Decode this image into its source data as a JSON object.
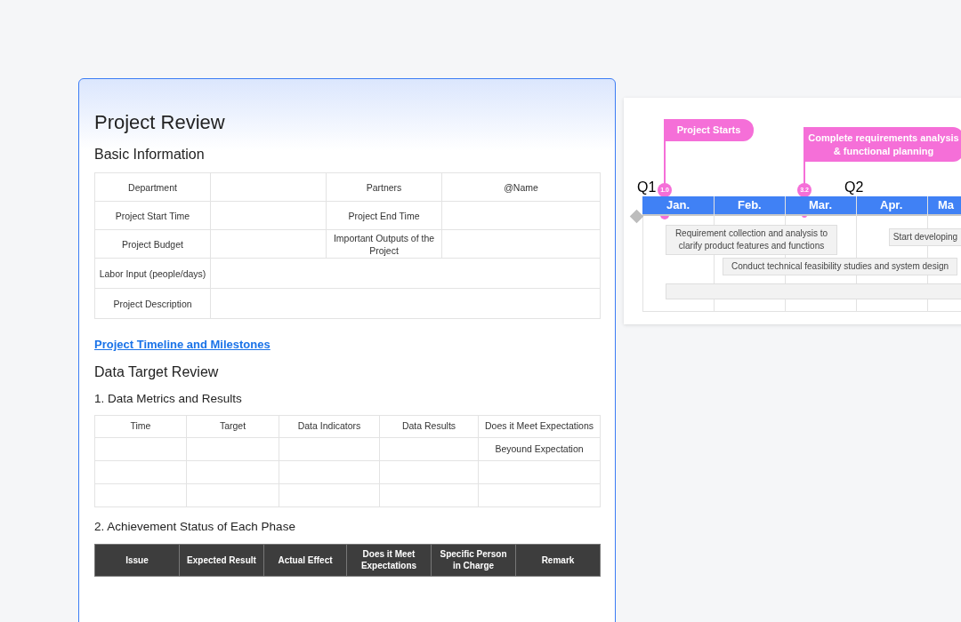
{
  "document": {
    "title": "Project Review",
    "sections": [
      {
        "kind": "heading",
        "text": "Basic Information"
      },
      {
        "kind": "info_table",
        "rows": [
          {
            "cells": [
              "Department",
              "",
              "Partners",
              "@Name"
            ]
          },
          {
            "cells": [
              "Project Start Time",
              "",
              "Project End Time",
              ""
            ]
          },
          {
            "cells": [
              "Project Budget",
              "",
              "Important Outputs of the Project",
              ""
            ]
          },
          {
            "cells": [
              "Labor Input (people/days)",
              ""
            ]
          },
          {
            "cells": [
              "Project Description",
              ""
            ]
          }
        ]
      },
      {
        "kind": "link",
        "text": "Project Timeline and Milestones"
      },
      {
        "kind": "heading",
        "text": "Data Target Review"
      },
      {
        "kind": "subheading",
        "text": "1. Data Metrics and Results"
      },
      {
        "kind": "grid_table",
        "columns": [
          "Time",
          "Target",
          "Data Indicators",
          "Data Results",
          "Does it Meet Expectations"
        ],
        "rows": [
          [
            "",
            "",
            "",
            "",
            "Beyound Expectation"
          ],
          [
            "",
            "",
            "",
            "",
            ""
          ],
          [
            "",
            "",
            "",
            "",
            ""
          ]
        ]
      },
      {
        "kind": "subheading",
        "text": "2. Achievement Status of Each Phase"
      },
      {
        "kind": "dark_table",
        "columns": [
          "Issue",
          "Expected Result",
          "Actual Effect",
          "Does it Meet Expectations",
          "Specific Person in Charge",
          "Remark"
        ]
      }
    ]
  },
  "timeline": {
    "quarters": [
      "Q1",
      "Q2"
    ],
    "months": [
      "Jan.",
      "Feb.",
      "Mar.",
      "Apr.",
      "Ma"
    ],
    "milestones": [
      {
        "label": "Project Starts",
        "marker": "1.0"
      },
      {
        "label": "Complete requirements analysis & functional planning",
        "marker": "3.2"
      }
    ],
    "tasks": [
      "Requirement collection and analysis to clarify product features and functions",
      "Start developing",
      "Conduct technical feasibility studies and system design"
    ]
  }
}
